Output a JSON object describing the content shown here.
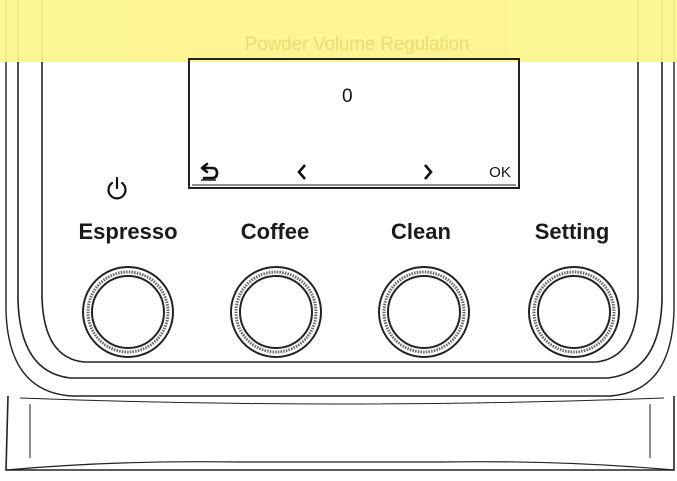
{
  "banner": {
    "title": "Powder Volume Regulation"
  },
  "display": {
    "value": "0",
    "keys": [
      {
        "icon": "return-icon"
      },
      {
        "icon": "chevron-left-icon"
      },
      {
        "icon": "chevron-right-icon"
      },
      {
        "icon": "ok-text",
        "label": "OK"
      }
    ]
  },
  "buttons": [
    {
      "label": "Espresso",
      "icon_above": "power-icon"
    },
    {
      "label": "Coffee"
    },
    {
      "label": "Clean"
    },
    {
      "label": "Setting"
    }
  ],
  "colors": {
    "banner": "#fdf58c",
    "banner_text": "#e9d96a",
    "line": "#222222"
  }
}
